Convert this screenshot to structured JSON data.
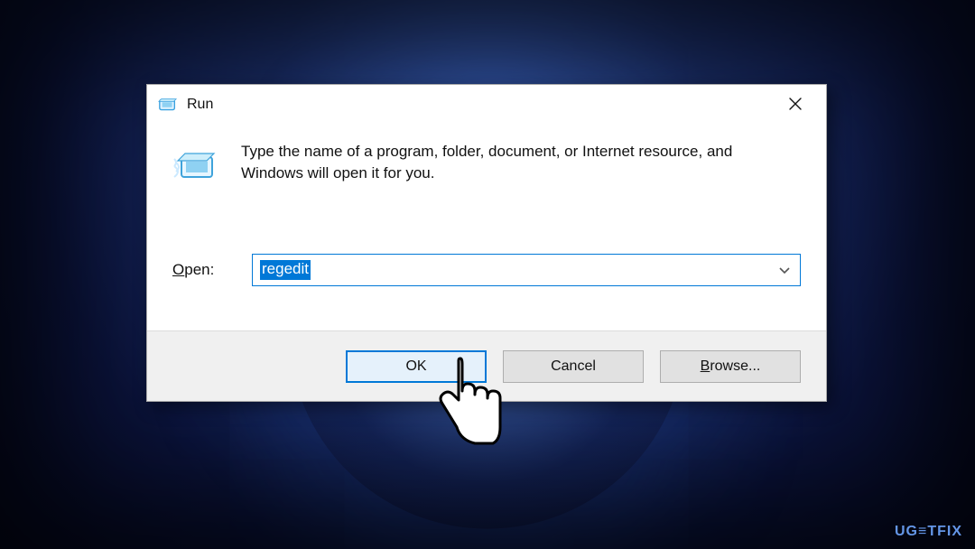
{
  "dialog": {
    "title": "Run",
    "description": "Type the name of a program, folder, document, or Internet resource, and Windows will open it for you.",
    "open_label_pre": "O",
    "open_label_rest": "pen:",
    "open_value": "regedit",
    "buttons": {
      "ok": "OK",
      "cancel": "Cancel",
      "browse_pre": "B",
      "browse_rest": "rowse..."
    }
  },
  "watermark": "UG≡TFIX"
}
